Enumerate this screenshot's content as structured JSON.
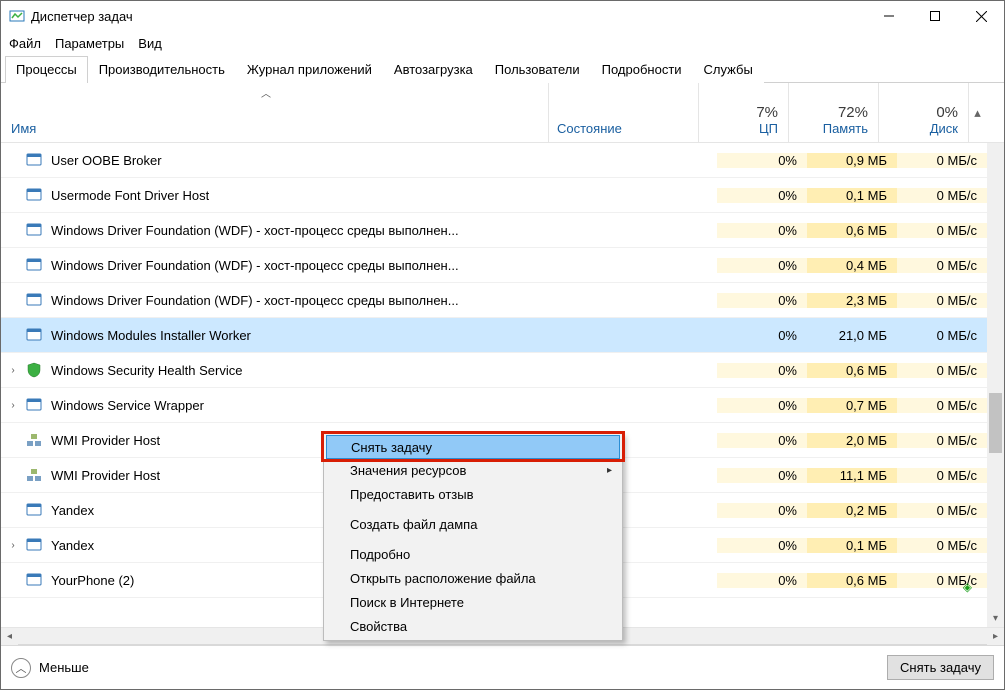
{
  "window": {
    "title": "Диспетчер задач"
  },
  "menu": {
    "file": "Файл",
    "options": "Параметры",
    "view": "Вид"
  },
  "tabs": {
    "processes": "Процессы",
    "performance": "Производительность",
    "apphistory": "Журнал приложений",
    "startup": "Автозагрузка",
    "users": "Пользователи",
    "details": "Подробности",
    "services": "Службы"
  },
  "columns": {
    "name": "Имя",
    "state": "Состояние",
    "cpu_pct": "7%",
    "cpu_lbl": "ЦП",
    "mem_pct": "72%",
    "mem_lbl": "Память",
    "disk_pct": "0%",
    "disk_lbl": "Диск"
  },
  "processes": [
    {
      "exp": "",
      "icon": "win",
      "name": "User OOBE Broker",
      "cpu": "0%",
      "mem": "0,9 МБ",
      "disk": "0 МБ/с"
    },
    {
      "exp": "",
      "icon": "win",
      "name": "Usermode Font Driver Host",
      "cpu": "0%",
      "mem": "0,1 МБ",
      "disk": "0 МБ/с"
    },
    {
      "exp": "",
      "icon": "win",
      "name": "Windows Driver Foundation (WDF) - хост-процесс среды выполнен...",
      "cpu": "0%",
      "mem": "0,6 МБ",
      "disk": "0 МБ/с"
    },
    {
      "exp": "",
      "icon": "win",
      "name": "Windows Driver Foundation (WDF) - хост-процесс среды выполнен...",
      "cpu": "0%",
      "mem": "0,4 МБ",
      "disk": "0 МБ/с"
    },
    {
      "exp": "",
      "icon": "win",
      "name": "Windows Driver Foundation (WDF) - хост-процесс среды выполнен...",
      "cpu": "0%",
      "mem": "2,3 МБ",
      "disk": "0 МБ/с"
    },
    {
      "exp": "",
      "icon": "win",
      "name": "Windows Modules Installer Worker",
      "cpu": "0%",
      "mem": "21,0 МБ",
      "disk": "0 МБ/с",
      "selected": true
    },
    {
      "exp": "›",
      "icon": "sec",
      "name": "Windows Security Health Service",
      "cpu": "0%",
      "mem": "0,6 МБ",
      "disk": "0 МБ/с"
    },
    {
      "exp": "›",
      "icon": "win",
      "name": "Windows Service Wrapper",
      "cpu": "0%",
      "mem": "0,7 МБ",
      "disk": "0 МБ/с"
    },
    {
      "exp": "",
      "icon": "wmi",
      "name": "WMI Provider Host",
      "cpu": "0%",
      "mem": "2,0 МБ",
      "disk": "0 МБ/с"
    },
    {
      "exp": "",
      "icon": "wmi",
      "name": "WMI Provider Host",
      "cpu": "0%",
      "mem": "11,1 МБ",
      "disk": "0 МБ/с"
    },
    {
      "exp": "",
      "icon": "win",
      "name": "Yandex",
      "cpu": "0%",
      "mem": "0,2 МБ",
      "disk": "0 МБ/с"
    },
    {
      "exp": "›",
      "icon": "win",
      "name": "Yandex",
      "cpu": "0%",
      "mem": "0,1 МБ",
      "disk": "0 МБ/с"
    },
    {
      "exp": "",
      "icon": "win",
      "name": "YourPhone (2)",
      "cpu": "0%",
      "mem": "0,6 МБ",
      "disk": "0 МБ/с",
      "leaf": true
    }
  ],
  "context_menu": {
    "end_task": "Снять задачу",
    "resource_values": "Значения ресурсов",
    "feedback": "Предоставить отзыв",
    "create_dump": "Создать файл дампа",
    "details": "Подробно",
    "open_location": "Открыть расположение файла",
    "search_web": "Поиск в Интернете",
    "properties": "Свойства"
  },
  "footer": {
    "less": "Меньше",
    "end_task": "Снять задачу"
  }
}
